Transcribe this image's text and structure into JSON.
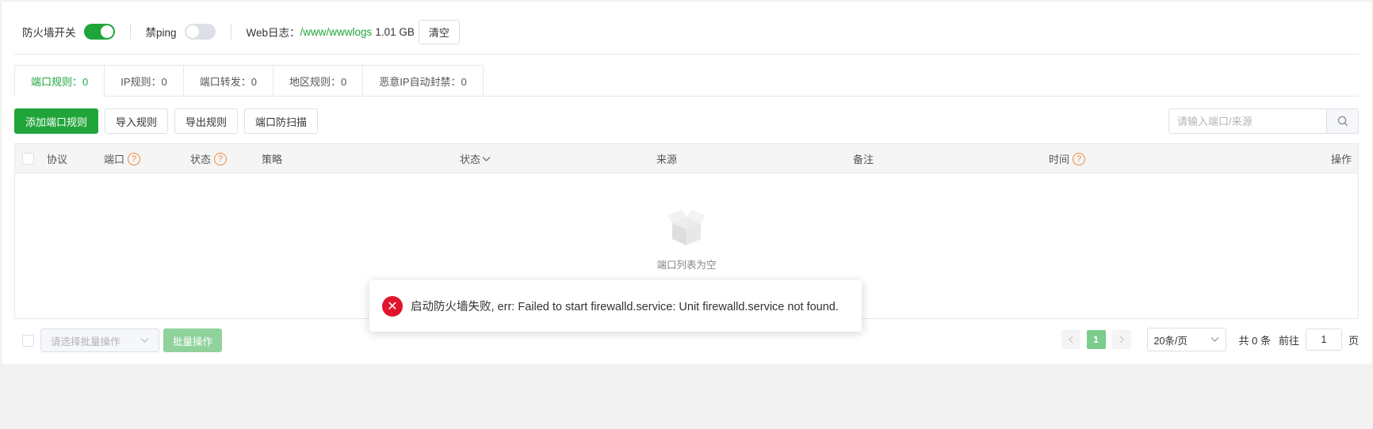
{
  "topbar": {
    "firewall_label": "防火墙开关",
    "firewall_on": true,
    "ping_label": "禁ping",
    "ping_on": false,
    "weblog_label": "Web日志：",
    "weblog_path": "/www/wwwlogs",
    "weblog_size": "1.01 GB",
    "clear_label": "清空"
  },
  "tabs": [
    {
      "label": "端口规则：0",
      "active": true
    },
    {
      "label": "IP规则：0",
      "active": false
    },
    {
      "label": "端口转发：0",
      "active": false
    },
    {
      "label": "地区规则：0",
      "active": false
    },
    {
      "label": "恶意IP自动封禁：0",
      "active": false
    }
  ],
  "actions": {
    "add": "添加端口规则",
    "import": "导入规则",
    "export": "导出规则",
    "scan": "端口防扫描"
  },
  "search": {
    "placeholder": "请输入端口/来源"
  },
  "table": {
    "columns": {
      "protocol": "协议",
      "port": "端口",
      "status": "状态",
      "strategy": "策略",
      "status2": "状态",
      "source": "来源",
      "remark": "备注",
      "time": "时间",
      "operation": "操作"
    },
    "empty_text": "端口列表为空"
  },
  "footer": {
    "batch_placeholder": "请选择批量操作",
    "batch_button": "批量操作",
    "page": "1",
    "page_size": "20条/页",
    "total": "共 0 条",
    "goto": "前往",
    "goto_value": "1",
    "page_suffix": "页"
  },
  "toast": {
    "message": "启动防火墙失败, err: Failed to start firewalld.service: Unit firewalld.service not found."
  },
  "colors": {
    "accent": "#20a53a",
    "error": "#e0152d",
    "help": "#f0883a"
  }
}
